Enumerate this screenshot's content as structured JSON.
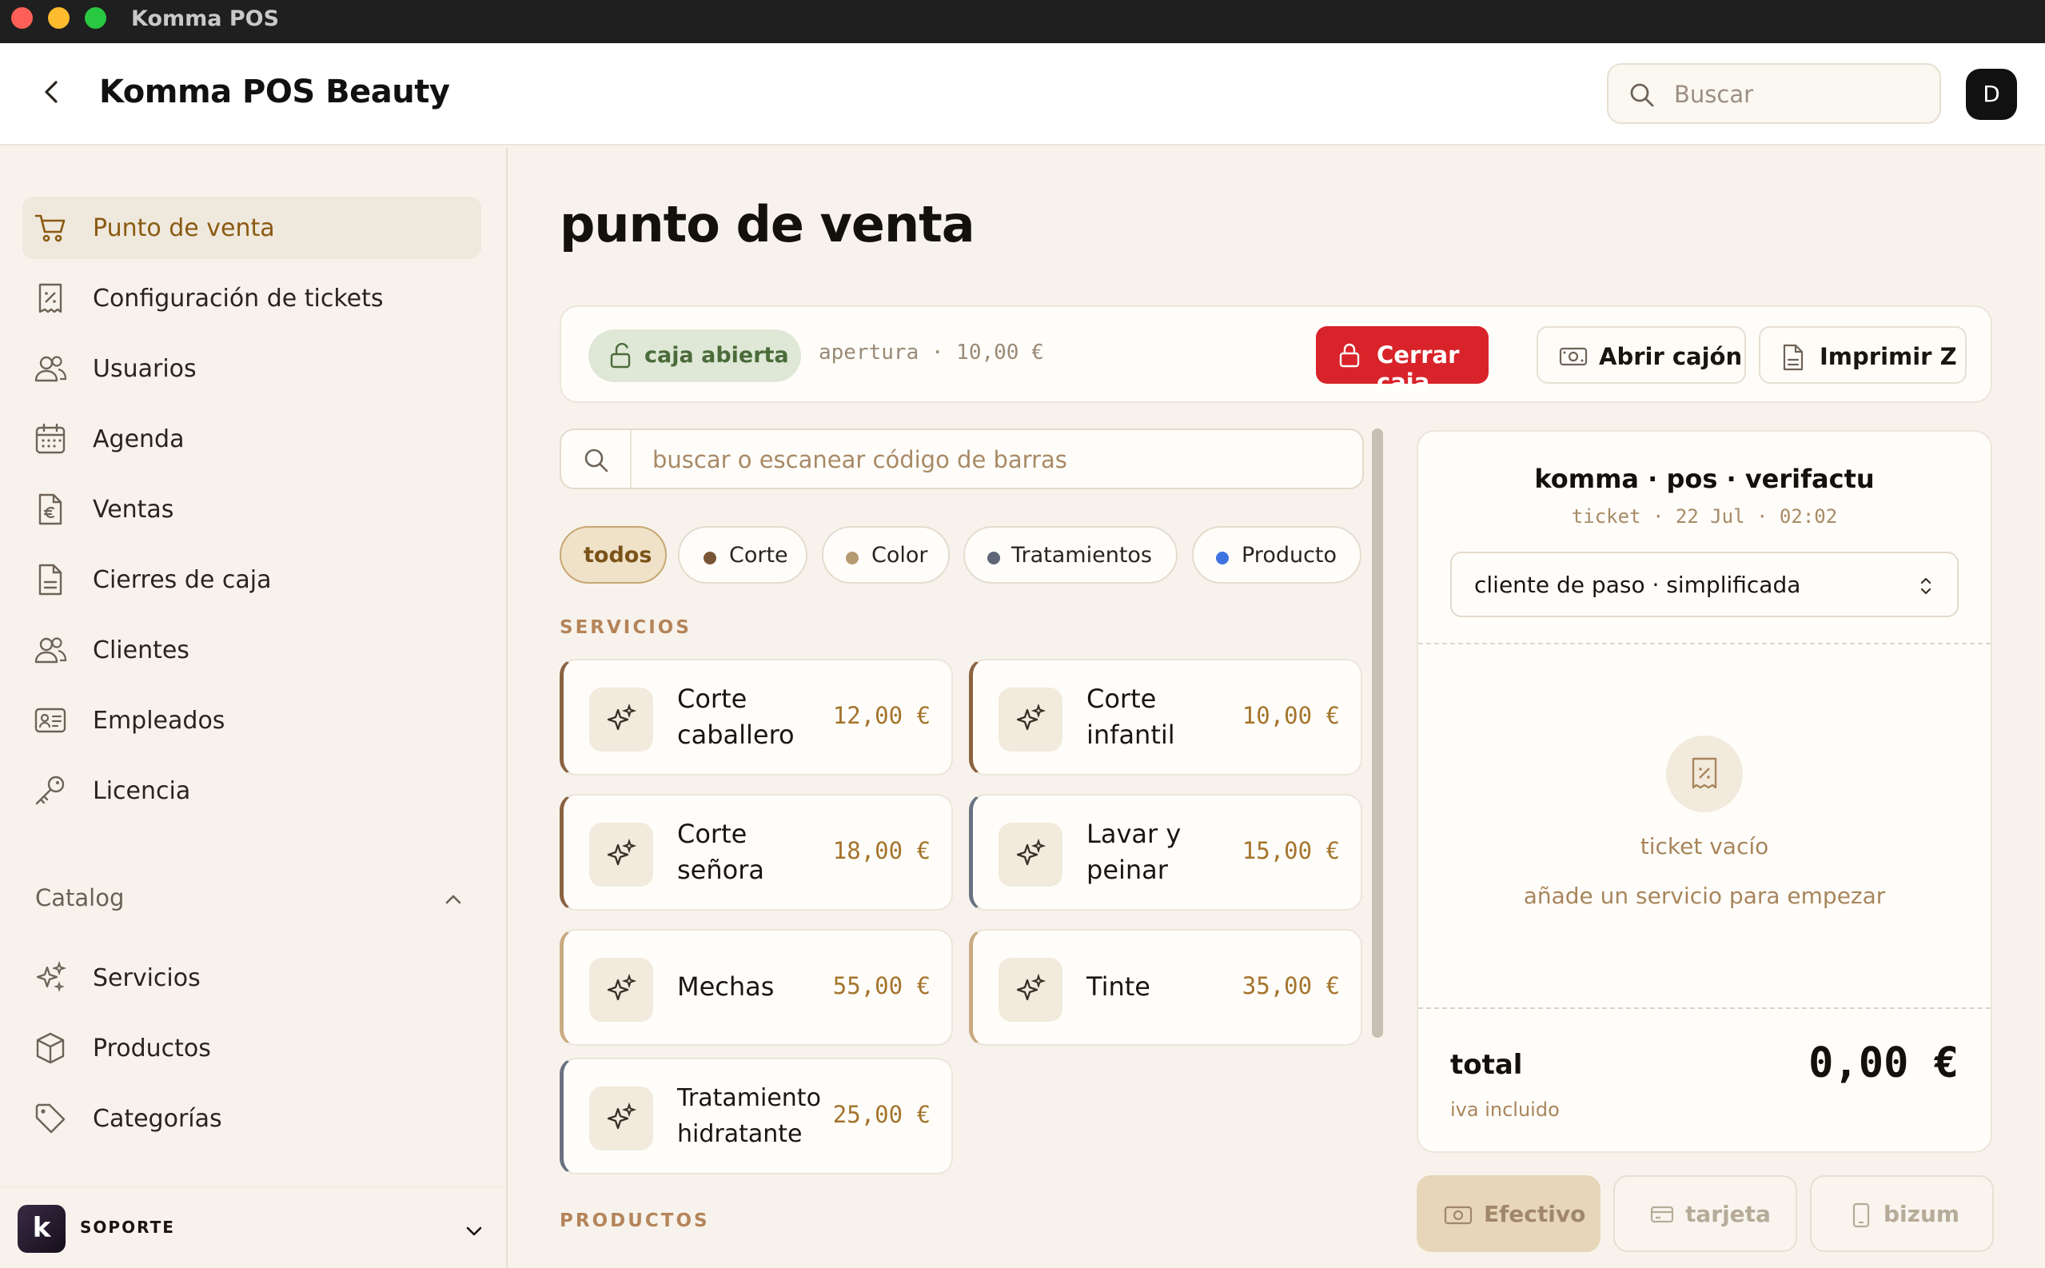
{
  "window": {
    "title": "Komma POS"
  },
  "header": {
    "title": "Komma POS Beauty",
    "search_placeholder": "Buscar",
    "avatar_initial": "D"
  },
  "sidebar": {
    "items": [
      {
        "label": "Punto de venta",
        "icon": "cart-icon",
        "active": true
      },
      {
        "label": "Configuración de tickets",
        "icon": "receipt-percent-icon"
      },
      {
        "label": "Usuarios",
        "icon": "users-icon"
      },
      {
        "label": "Agenda",
        "icon": "calendar-icon"
      },
      {
        "label": "Ventas",
        "icon": "euro-document-icon"
      },
      {
        "label": "Cierres de caja",
        "icon": "document-icon"
      },
      {
        "label": "Clientes",
        "icon": "users-icon"
      },
      {
        "label": "Empleados",
        "icon": "id-card-icon"
      },
      {
        "label": "Licencia",
        "icon": "key-icon"
      }
    ],
    "catalog": {
      "heading": "Catalog",
      "items": [
        {
          "label": "Servicios",
          "icon": "sparkles-icon"
        },
        {
          "label": "Productos",
          "icon": "box-icon"
        },
        {
          "label": "Categorías",
          "icon": "tag-icon"
        }
      ]
    },
    "support": {
      "logo_letter": "k",
      "label": "SOPORTE"
    }
  },
  "main": {
    "title": "punto de venta",
    "cash": {
      "status": "caja abierta",
      "opening": "apertura · 10,00 €",
      "close_button": "Cerrar caja",
      "drawer_button": "Abrir cajón",
      "print_button": "Imprimir Z"
    },
    "scan_placeholder": "buscar o escanear código de barras",
    "filters": [
      {
        "label": "todos",
        "color": null,
        "active": true
      },
      {
        "label": "Corte",
        "color": "#7a5535"
      },
      {
        "label": "Color",
        "color": "#b59a72"
      },
      {
        "label": "Tratamientos",
        "color": "#5e6678"
      },
      {
        "label": "Producto",
        "color": "#3f73e0"
      }
    ],
    "services_heading": "SERVICIOS",
    "services": [
      {
        "name": "Corte caballero",
        "price": "12,00 €",
        "accent": "#8a6240"
      },
      {
        "name": "Corte infantil",
        "price": "10,00 €",
        "accent": "#8a6240"
      },
      {
        "name": "Corte señora",
        "price": "18,00 €",
        "accent": "#8a6240"
      },
      {
        "name": "Lavar y peinar",
        "price": "15,00 €",
        "accent": "#6b7180"
      },
      {
        "name": "Mechas",
        "price": "55,00 €",
        "accent": "#c9aa82"
      },
      {
        "name": "Tinte",
        "price": "35,00 €",
        "accent": "#c9aa82"
      },
      {
        "name": "Tratamiento hidratante",
        "price": "25,00 €",
        "accent": "#6b7180"
      }
    ],
    "products_heading": "PRODUCTOS"
  },
  "ticket": {
    "brand": "komma · pos · verifactu",
    "meta": "ticket · 22 Jul · 02:02",
    "customer_select": "cliente de paso · simplificada",
    "empty_title": "ticket vacío",
    "empty_subtitle": "añade un servicio para empezar",
    "total_label": "total",
    "total_value": "0,00 €",
    "total_note": "iva incluido"
  },
  "payments": [
    {
      "label": "Efectivo",
      "icon": "cash-icon",
      "active": true
    },
    {
      "label": "tarjeta",
      "icon": "card-icon"
    },
    {
      "label": "bizum",
      "icon": "phone-icon"
    }
  ]
}
